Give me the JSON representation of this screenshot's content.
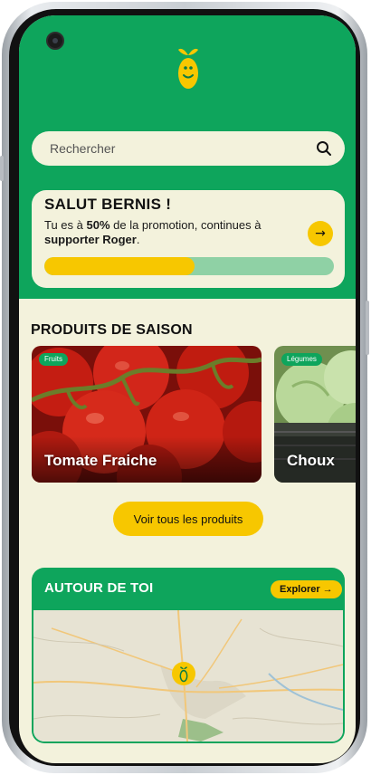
{
  "search": {
    "placeholder": "Rechercher",
    "icon": "search-icon"
  },
  "promo": {
    "title": "SALUT BERNIS !",
    "text_before": "Tu es à ",
    "percent": "50%",
    "text_middle": " de la promotion, continues à ",
    "target": "supporter Roger",
    "text_end": ".",
    "progress_fraction": 0.52
  },
  "season": {
    "title": "PRODUITS DE SAISON",
    "products": [
      {
        "tag": "Fruits",
        "name": "Tomate Fraiche"
      },
      {
        "tag": "Légumes",
        "name": "Choux"
      }
    ],
    "all_button": "Voir tous les produits"
  },
  "around": {
    "title": "AUTOUR DE TOI",
    "explore_label": "Explorer →"
  },
  "colors": {
    "primary_green": "#0ea55c",
    "accent_yellow": "#f7c700",
    "background_cream": "#f3f2dc"
  }
}
